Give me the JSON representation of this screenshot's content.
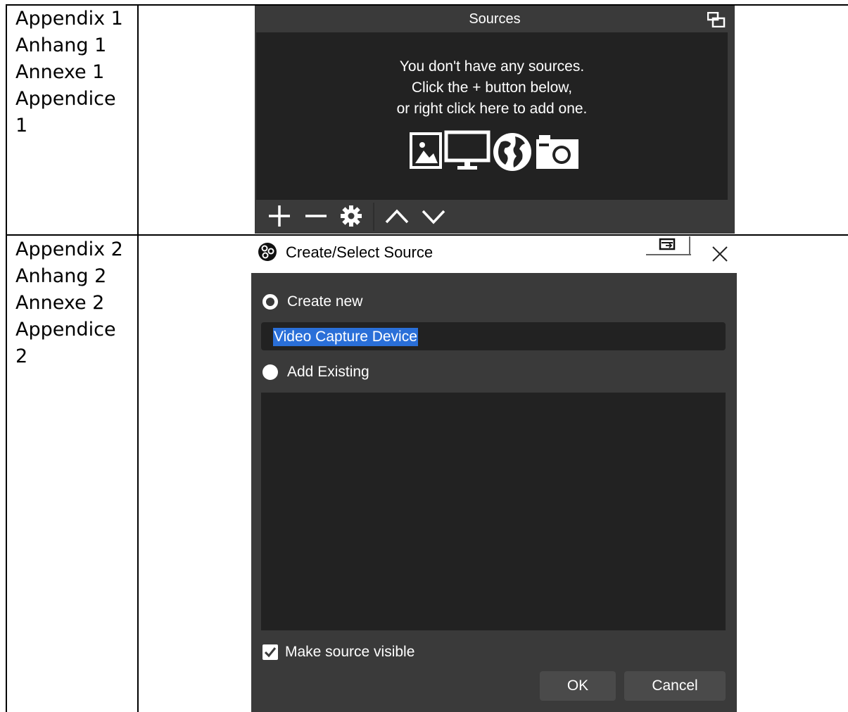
{
  "appendix_rows": [
    {
      "lines": [
        "Appendix 1",
        "Anhang 1",
        "Annexe 1",
        "Appendice",
        "1"
      ]
    },
    {
      "lines": [
        "Appendix 2",
        "Anhang 2",
        "Annexe 2",
        "Appendice",
        "2"
      ]
    }
  ],
  "sources_panel": {
    "title": "Sources",
    "empty_message": [
      "You don't have any sources.",
      "Click the + button below,",
      "or right click here to add one."
    ],
    "icons": [
      "image-icon",
      "display-icon",
      "globe-icon",
      "camera-icon"
    ],
    "toolbar": [
      "add-icon",
      "remove-icon",
      "settings-icon",
      "move-up-icon",
      "move-down-icon"
    ]
  },
  "dialog": {
    "title": "Create/Select Source",
    "create_new_label": "Create new",
    "create_new_selected": true,
    "source_name_value": "Video Capture Device",
    "add_existing_label": "Add Existing",
    "make_visible_label": "Make source visible",
    "make_visible_checked": true,
    "ok_label": "OK",
    "cancel_label": "Cancel"
  },
  "colors": {
    "panel_bg": "#3a3a3a",
    "panel_inner": "#222222",
    "selection": "#2a6fd8"
  }
}
